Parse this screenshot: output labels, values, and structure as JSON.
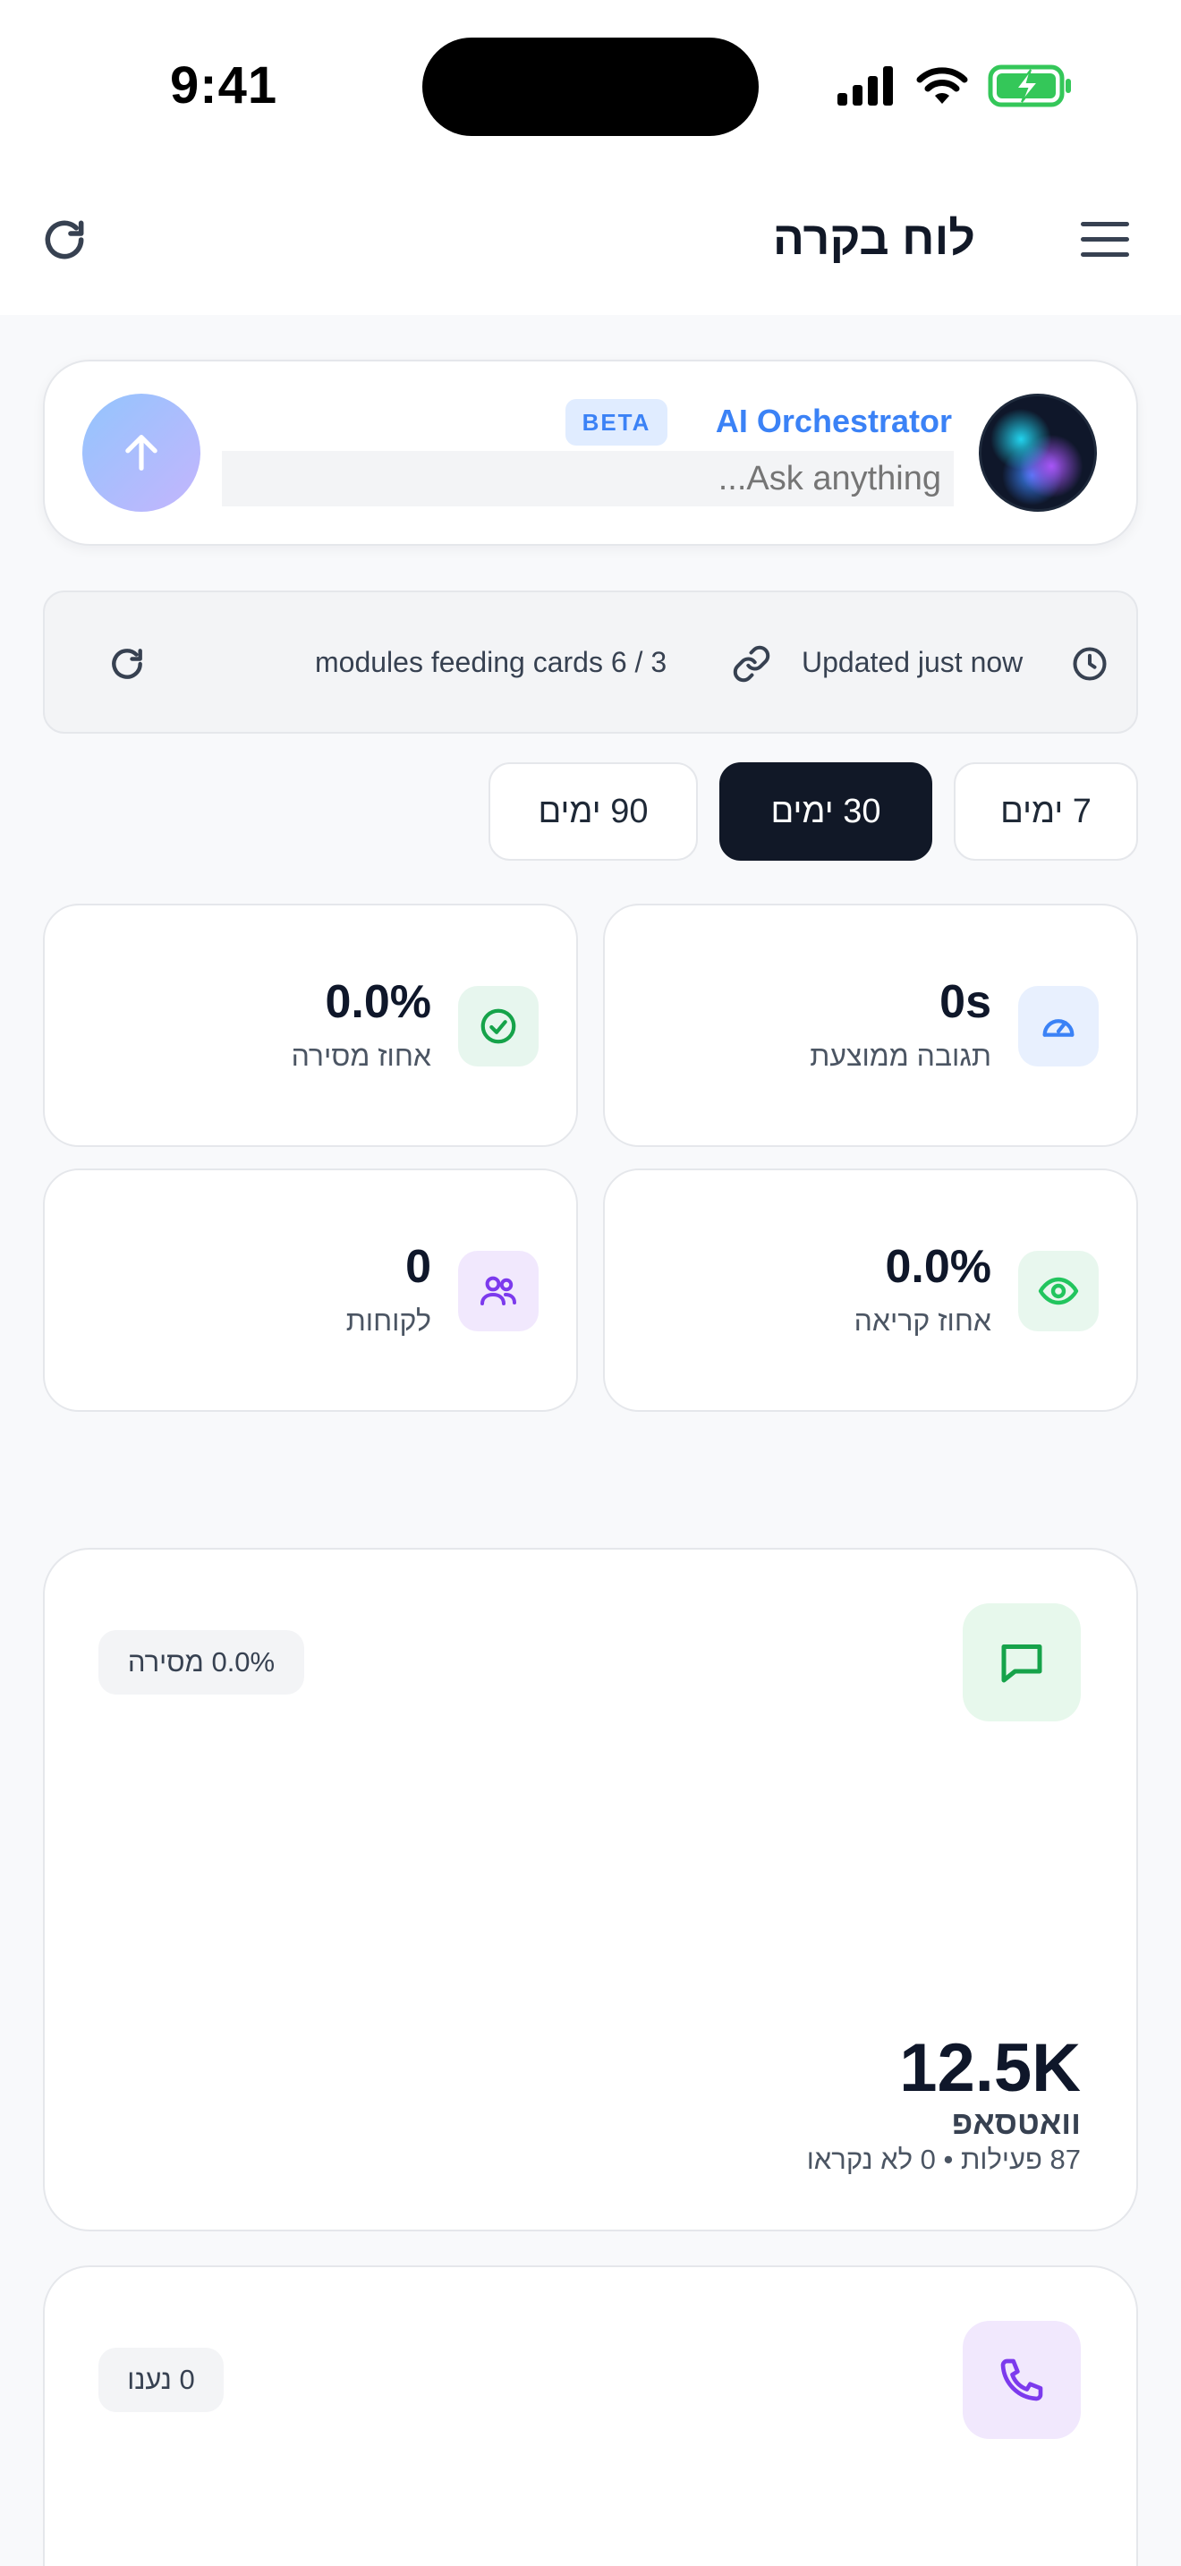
{
  "status_bar": {
    "time": "9:41"
  },
  "header": {
    "title": "לוח בקרה",
    "menu_icon": "hamburger-menu-icon",
    "refresh_icon": "refresh-icon"
  },
  "ai": {
    "name": "AI Orchestrator",
    "badge": "BETA",
    "placeholder": "...Ask anything",
    "send_icon": "arrow-up-icon"
  },
  "status": {
    "updated": "Updated just now",
    "modules": "modules feeding cards 6 / 3"
  },
  "ranges": [
    {
      "label": "7 ימים",
      "active": false
    },
    {
      "label": "30 ימים",
      "active": true
    },
    {
      "label": "90 ימים",
      "active": false
    }
  ],
  "kpis": {
    "avg_response": {
      "value": "0s",
      "label": "תגובה ממוצעת",
      "icon": "gauge-icon",
      "color": "#3b82f6"
    },
    "delivery_rate": {
      "value": "0.0%",
      "label": "אחוז מסירה",
      "icon": "check-circle-icon",
      "color": "#16a34a"
    },
    "read_rate": {
      "value": "0.0%",
      "label": "אחוז קריאה",
      "icon": "eye-icon",
      "color": "#22c55e"
    },
    "customers": {
      "value": "0",
      "label": "לקוחות",
      "icon": "users-icon",
      "color": "#7c3aed"
    }
  },
  "whatsapp_card": {
    "icon": "message-square-icon",
    "pill": "0.0% מסירה",
    "value": "12.5K",
    "title": "וואטסאפ",
    "subtitle": "87 פעילות • 0 לא נקראו"
  },
  "calls_card": {
    "icon": "phone-icon",
    "pill": "0 נענו"
  }
}
